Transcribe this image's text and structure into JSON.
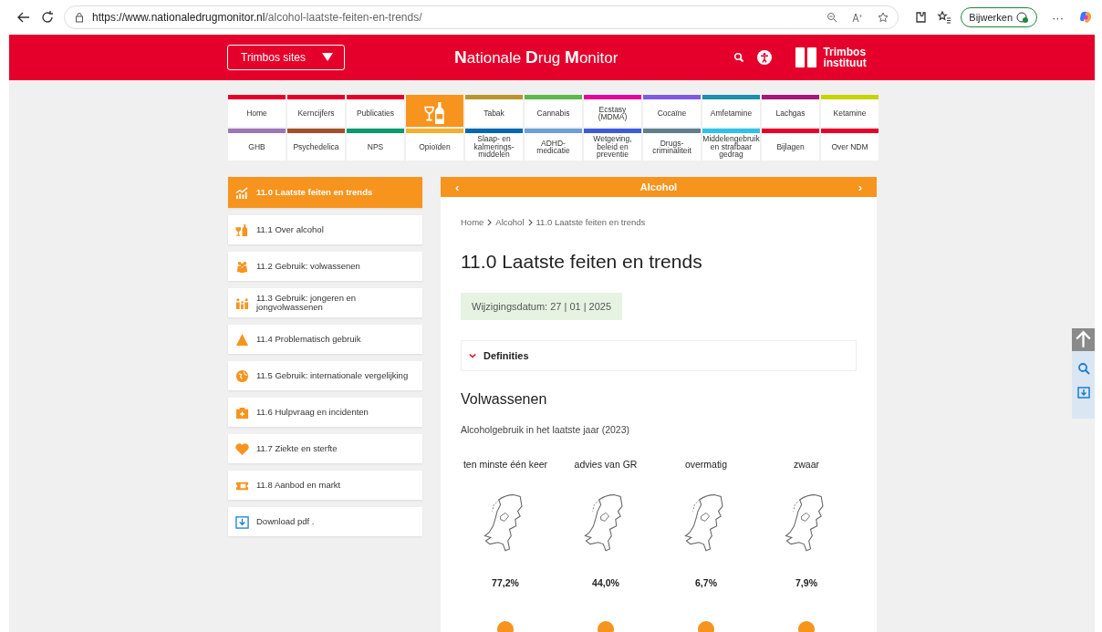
{
  "browser": {
    "url_host": "https://www.nationaledrugmonitor.nl",
    "url_path": "/alcohol-laatste-feiten-en-trends/",
    "update_button": "Bijwerken",
    "more": "···"
  },
  "header": {
    "sites_button": "Trimbos sites",
    "title": "**N**ationale **D**rug **M**onitor",
    "logo_line1": "Trimbos",
    "logo_line2": "instituut"
  },
  "nav": [
    [
      {
        "kind": "text",
        "label": "Home",
        "color": "#e4002b",
        "selected": false
      },
      {
        "kind": "text",
        "label": "Kerncijfers",
        "color": "#e4002b",
        "selected": false
      },
      {
        "kind": "text",
        "label": "Publicaties",
        "color": "#e4002b",
        "selected": false
      },
      {
        "kind": "icon",
        "color": "#f7941d",
        "selected": true
      },
      {
        "kind": "text",
        "label": "Tabak",
        "color": "#b8962e",
        "selected": false
      },
      {
        "kind": "text",
        "label": "Cannabis",
        "color": "#5cb84a",
        "selected": false
      },
      {
        "kind": "text",
        "label": "Ecstasy (MDMA)",
        "color": "#e0079a",
        "selected": false
      },
      {
        "kind": "text",
        "label": "Cocaïne",
        "color": "#7f5ae0",
        "selected": false
      },
      {
        "kind": "text",
        "label": "Amfetamine",
        "color": "#1a8fb0",
        "selected": false
      },
      {
        "kind": "text",
        "label": "Lachgas",
        "color": "#a3187a",
        "selected": false
      },
      {
        "kind": "text",
        "label": "Ketamine",
        "color": "#c8d400",
        "selected": false
      }
    ],
    [
      {
        "kind": "text",
        "label": "GHB",
        "color": "#9b77b8",
        "selected": false
      },
      {
        "kind": "text",
        "label": "Psychedelica",
        "color": "#a0522d",
        "selected": false
      },
      {
        "kind": "text",
        "label": "NPS",
        "color": "#0a9a6e",
        "selected": false
      },
      {
        "kind": "text",
        "label": "Opioïden",
        "color": "#f2b134",
        "selected": false
      },
      {
        "kind": "text",
        "label": "Slaap- en kalmerings-middelen",
        "color": "#0067b1",
        "selected": false
      },
      {
        "kind": "text",
        "label": "ADHD-medicatie",
        "color": "#6ea0d6",
        "selected": false
      },
      {
        "kind": "text",
        "label": "Wetgeving, beleid en preventie",
        "color": "#3d5bd9",
        "selected": false
      },
      {
        "kind": "text",
        "label": "Drugs-criminaliteit",
        "color": "#5f7f8f",
        "selected": false
      },
      {
        "kind": "text",
        "label": "Middelengebruik en strafbaar gedrag",
        "color": "#2ec2ea",
        "selected": false
      },
      {
        "kind": "text",
        "label": "Bijlagen",
        "color": "#e4002b",
        "selected": false
      },
      {
        "kind": "text",
        "label": "Over NDM",
        "color": "#e4002b",
        "selected": false
      }
    ]
  ],
  "sidebar": [
    {
      "label": "11.0 Laatste feiten en trends",
      "kind": "trend",
      "selected": true
    },
    {
      "label": "11.1 Over alcohol",
      "kind": "drinks",
      "selected": false
    },
    {
      "label": "11.2 Gebruik: volwassenen",
      "kind": "people",
      "selected": false
    },
    {
      "label": "11.3 Gebruik: jongeren en jongvolwassenen",
      "kind": "family",
      "selected": false
    },
    {
      "label": "11.4 Problematisch gebruik",
      "kind": "warning",
      "selected": false
    },
    {
      "label": "11.5 Gebruik: internationale vergelijking",
      "kind": "globe",
      "selected": false
    },
    {
      "label": "11.6 Hulpvraag en incidenten",
      "kind": "medkit",
      "selected": false
    },
    {
      "label": "11.7 Ziekte en sterfte",
      "kind": "heart",
      "selected": false
    },
    {
      "label": "11.8 Aanbod en markt",
      "kind": "ticket",
      "selected": false
    },
    {
      "label": "Download pdf .",
      "kind": "download",
      "selected": false
    }
  ],
  "section_bar": {
    "prev": "‹",
    "title": "Alcohol",
    "next": "›"
  },
  "breadcrumb": [
    "Home",
    "Alcohol",
    "11.0 Laatste feiten en trends"
  ],
  "page_title": "11.0 Laatste feiten en trends",
  "modified": "Wijzigingsdatum: 27 | 01 | 2025",
  "accordion": {
    "label": "Definities",
    "expanded": false
  },
  "section_heading": "Volwassenen",
  "chart_caption": "Alcoholgebruik in het laatste jaar (2023)",
  "stats": [
    {
      "label": "ten minste één keer",
      "value": "77,2%"
    },
    {
      "label": "advies van GR",
      "value": "44,0%"
    },
    {
      "label": "overmatig",
      "value": "6,7%"
    },
    {
      "label": "zwaar",
      "value": "7,9%"
    }
  ]
}
